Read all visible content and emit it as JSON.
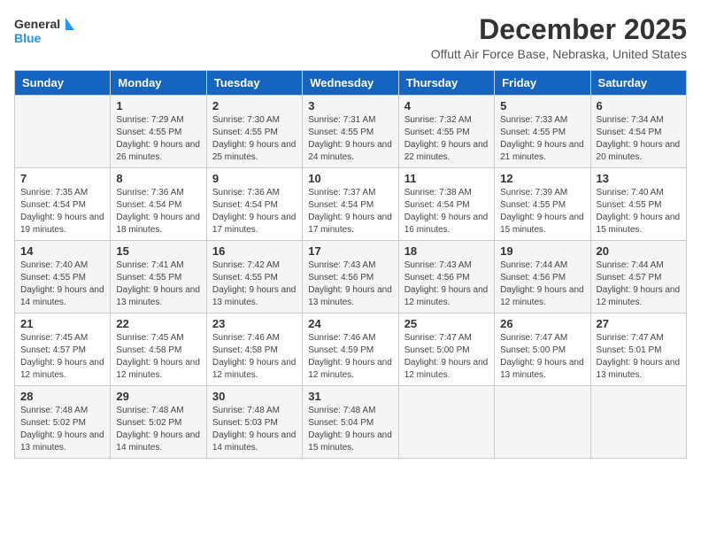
{
  "logo": {
    "line1": "General",
    "line2": "Blue"
  },
  "title": "December 2025",
  "subtitle": "Offutt Air Force Base, Nebraska, United States",
  "days_of_week": [
    "Sunday",
    "Monday",
    "Tuesday",
    "Wednesday",
    "Thursday",
    "Friday",
    "Saturday"
  ],
  "weeks": [
    [
      {
        "day": "",
        "sunrise": "",
        "sunset": "",
        "daylight": ""
      },
      {
        "day": "1",
        "sunrise": "Sunrise: 7:29 AM",
        "sunset": "Sunset: 4:55 PM",
        "daylight": "Daylight: 9 hours and 26 minutes."
      },
      {
        "day": "2",
        "sunrise": "Sunrise: 7:30 AM",
        "sunset": "Sunset: 4:55 PM",
        "daylight": "Daylight: 9 hours and 25 minutes."
      },
      {
        "day": "3",
        "sunrise": "Sunrise: 7:31 AM",
        "sunset": "Sunset: 4:55 PM",
        "daylight": "Daylight: 9 hours and 24 minutes."
      },
      {
        "day": "4",
        "sunrise": "Sunrise: 7:32 AM",
        "sunset": "Sunset: 4:55 PM",
        "daylight": "Daylight: 9 hours and 22 minutes."
      },
      {
        "day": "5",
        "sunrise": "Sunrise: 7:33 AM",
        "sunset": "Sunset: 4:55 PM",
        "daylight": "Daylight: 9 hours and 21 minutes."
      },
      {
        "day": "6",
        "sunrise": "Sunrise: 7:34 AM",
        "sunset": "Sunset: 4:54 PM",
        "daylight": "Daylight: 9 hours and 20 minutes."
      }
    ],
    [
      {
        "day": "7",
        "sunrise": "Sunrise: 7:35 AM",
        "sunset": "Sunset: 4:54 PM",
        "daylight": "Daylight: 9 hours and 19 minutes."
      },
      {
        "day": "8",
        "sunrise": "Sunrise: 7:36 AM",
        "sunset": "Sunset: 4:54 PM",
        "daylight": "Daylight: 9 hours and 18 minutes."
      },
      {
        "day": "9",
        "sunrise": "Sunrise: 7:36 AM",
        "sunset": "Sunset: 4:54 PM",
        "daylight": "Daylight: 9 hours and 17 minutes."
      },
      {
        "day": "10",
        "sunrise": "Sunrise: 7:37 AM",
        "sunset": "Sunset: 4:54 PM",
        "daylight": "Daylight: 9 hours and 17 minutes."
      },
      {
        "day": "11",
        "sunrise": "Sunrise: 7:38 AM",
        "sunset": "Sunset: 4:54 PM",
        "daylight": "Daylight: 9 hours and 16 minutes."
      },
      {
        "day": "12",
        "sunrise": "Sunrise: 7:39 AM",
        "sunset": "Sunset: 4:55 PM",
        "daylight": "Daylight: 9 hours and 15 minutes."
      },
      {
        "day": "13",
        "sunrise": "Sunrise: 7:40 AM",
        "sunset": "Sunset: 4:55 PM",
        "daylight": "Daylight: 9 hours and 15 minutes."
      }
    ],
    [
      {
        "day": "14",
        "sunrise": "Sunrise: 7:40 AM",
        "sunset": "Sunset: 4:55 PM",
        "daylight": "Daylight: 9 hours and 14 minutes."
      },
      {
        "day": "15",
        "sunrise": "Sunrise: 7:41 AM",
        "sunset": "Sunset: 4:55 PM",
        "daylight": "Daylight: 9 hours and 13 minutes."
      },
      {
        "day": "16",
        "sunrise": "Sunrise: 7:42 AM",
        "sunset": "Sunset: 4:55 PM",
        "daylight": "Daylight: 9 hours and 13 minutes."
      },
      {
        "day": "17",
        "sunrise": "Sunrise: 7:43 AM",
        "sunset": "Sunset: 4:56 PM",
        "daylight": "Daylight: 9 hours and 13 minutes."
      },
      {
        "day": "18",
        "sunrise": "Sunrise: 7:43 AM",
        "sunset": "Sunset: 4:56 PM",
        "daylight": "Daylight: 9 hours and 12 minutes."
      },
      {
        "day": "19",
        "sunrise": "Sunrise: 7:44 AM",
        "sunset": "Sunset: 4:56 PM",
        "daylight": "Daylight: 9 hours and 12 minutes."
      },
      {
        "day": "20",
        "sunrise": "Sunrise: 7:44 AM",
        "sunset": "Sunset: 4:57 PM",
        "daylight": "Daylight: 9 hours and 12 minutes."
      }
    ],
    [
      {
        "day": "21",
        "sunrise": "Sunrise: 7:45 AM",
        "sunset": "Sunset: 4:57 PM",
        "daylight": "Daylight: 9 hours and 12 minutes."
      },
      {
        "day": "22",
        "sunrise": "Sunrise: 7:45 AM",
        "sunset": "Sunset: 4:58 PM",
        "daylight": "Daylight: 9 hours and 12 minutes."
      },
      {
        "day": "23",
        "sunrise": "Sunrise: 7:46 AM",
        "sunset": "Sunset: 4:58 PM",
        "daylight": "Daylight: 9 hours and 12 minutes."
      },
      {
        "day": "24",
        "sunrise": "Sunrise: 7:46 AM",
        "sunset": "Sunset: 4:59 PM",
        "daylight": "Daylight: 9 hours and 12 minutes."
      },
      {
        "day": "25",
        "sunrise": "Sunrise: 7:47 AM",
        "sunset": "Sunset: 5:00 PM",
        "daylight": "Daylight: 9 hours and 12 minutes."
      },
      {
        "day": "26",
        "sunrise": "Sunrise: 7:47 AM",
        "sunset": "Sunset: 5:00 PM",
        "daylight": "Daylight: 9 hours and 13 minutes."
      },
      {
        "day": "27",
        "sunrise": "Sunrise: 7:47 AM",
        "sunset": "Sunset: 5:01 PM",
        "daylight": "Daylight: 9 hours and 13 minutes."
      }
    ],
    [
      {
        "day": "28",
        "sunrise": "Sunrise: 7:48 AM",
        "sunset": "Sunset: 5:02 PM",
        "daylight": "Daylight: 9 hours and 13 minutes."
      },
      {
        "day": "29",
        "sunrise": "Sunrise: 7:48 AM",
        "sunset": "Sunset: 5:02 PM",
        "daylight": "Daylight: 9 hours and 14 minutes."
      },
      {
        "day": "30",
        "sunrise": "Sunrise: 7:48 AM",
        "sunset": "Sunset: 5:03 PM",
        "daylight": "Daylight: 9 hours and 14 minutes."
      },
      {
        "day": "31",
        "sunrise": "Sunrise: 7:48 AM",
        "sunset": "Sunset: 5:04 PM",
        "daylight": "Daylight: 9 hours and 15 minutes."
      },
      {
        "day": "",
        "sunrise": "",
        "sunset": "",
        "daylight": ""
      },
      {
        "day": "",
        "sunrise": "",
        "sunset": "",
        "daylight": ""
      },
      {
        "day": "",
        "sunrise": "",
        "sunset": "",
        "daylight": ""
      }
    ]
  ]
}
